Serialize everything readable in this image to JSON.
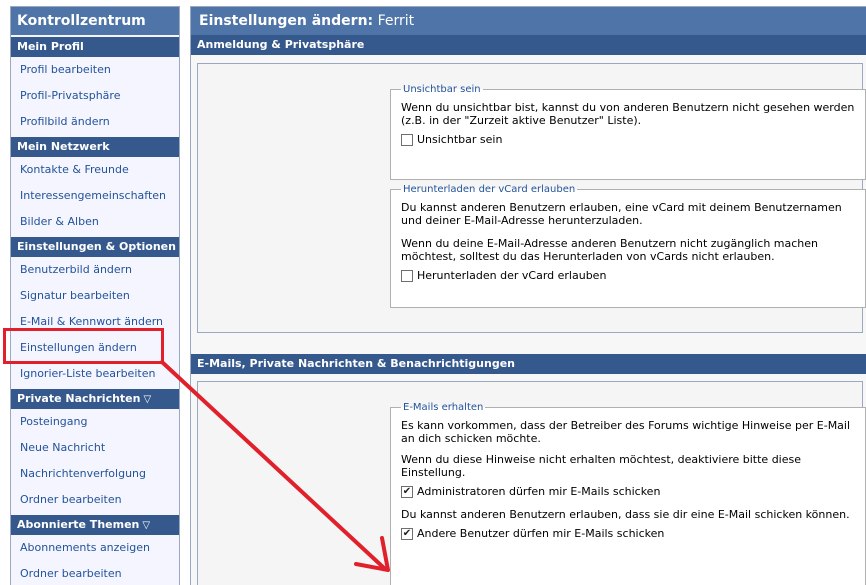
{
  "sidebar": {
    "title": "Kontrollzentrum",
    "sections": [
      {
        "label": "Mein Profil",
        "items": [
          "Profil bearbeiten",
          "Profil-Privatsphäre",
          "Profilbild ändern"
        ]
      },
      {
        "label": "Mein Netzwerk",
        "items": [
          "Kontakte & Freunde",
          "Interessengemeinschaften",
          "Bilder & Alben"
        ]
      },
      {
        "label": "Einstellungen & Optionen",
        "items": [
          "Benutzerbild ändern",
          "Signatur bearbeiten",
          "E-Mail & Kennwort ändern",
          "Einstellungen ändern",
          "Ignorier-Liste bearbeiten"
        ]
      },
      {
        "label": "Private Nachrichten",
        "items": [
          "Posteingang",
          "Neue Nachricht",
          "Nachrichtenverfolgung",
          "Ordner bearbeiten"
        ]
      },
      {
        "label": "Abonnierte Themen",
        "items": [
          "Abonnements anzeigen",
          "Ordner bearbeiten"
        ]
      }
    ]
  },
  "main": {
    "title_prefix": "Einstellungen ändern:",
    "title_user": "Ferrit",
    "sections": {
      "login_privacy": {
        "label": "Anmeldung & Privatsphäre",
        "invisible": {
          "legend": "Unsichtbar sein",
          "text": "Wenn du unsichtbar bist, kannst du von anderen Benutzern nicht gesehen werden (z.B. in der \"Zurzeit aktive Benutzer\" Liste).",
          "checkbox_label": "Unsichtbar sein",
          "checked": false
        },
        "vcard": {
          "legend": "Herunterladen der vCard erlauben",
          "text1": "Du kannst anderen Benutzern erlauben, eine vCard mit deinem Benutzernamen und deiner E-Mail-Adresse herunterzuladen.",
          "text2": "Wenn du deine E-Mail-Adresse anderen Benutzern nicht zugänglich machen möchtest, solltest du das Herunterladen von vCards nicht erlauben.",
          "checkbox_label": "Herunterladen der vCard erlauben",
          "checked": false
        }
      },
      "email_pm": {
        "label": "E-Mails, Private Nachrichten & Benachrichtigungen",
        "receive": {
          "legend": "E-Mails erhalten",
          "text1": "Es kann vorkommen, dass der Betreiber des Forums wichtige Hinweise per E-Mail an dich schicken möchte.",
          "text2": "Wenn du diese Hinweise nicht erhalten möchtest, deaktiviere bitte diese Einstellung.",
          "admin_checkbox_label": "Administratoren dürfen mir E-Mails schicken",
          "admin_checked": true,
          "text3": "Du kannst anderen Benutzern erlauben, dass sie dir eine E-Mail schicken können.",
          "users_checkbox_label": "Andere Benutzer dürfen mir E-Mails schicken",
          "users_checked": true
        }
      }
    }
  },
  "colors": {
    "header_blue": "#4f75a8",
    "section_blue": "#35598c",
    "link_blue": "#22539a",
    "annotation_red": "#e0202a"
  },
  "icons": {
    "collapse": "triangle-down-icon",
    "check": "checkmark-icon"
  }
}
